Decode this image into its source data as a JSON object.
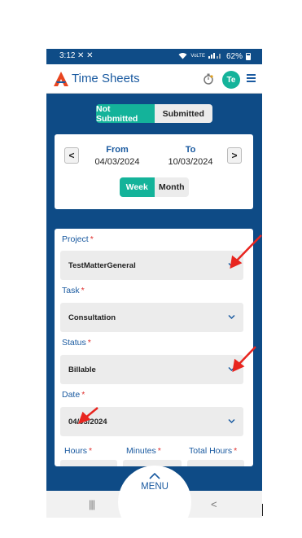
{
  "status_bar": {
    "time": "3:12",
    "notif_icons": "✕ ✕",
    "network": "VoLTE",
    "battery": "62%"
  },
  "header": {
    "title": "Time Sheets",
    "avatar_initials": "Te"
  },
  "submission_toggle": {
    "options": [
      "Not Submitted",
      "Submitted"
    ],
    "selected": "Not Submitted"
  },
  "date_range": {
    "from_label": "From",
    "from_value": "04/03/2024",
    "to_label": "To",
    "to_value": "10/03/2024",
    "prev": "<",
    "next": ">"
  },
  "range_toggle": {
    "options": [
      "Week",
      "Month"
    ],
    "selected": "Week"
  },
  "form": {
    "project": {
      "label": "Project",
      "value": "TestMatterGeneral"
    },
    "task": {
      "label": "Task",
      "value": "Consultation"
    },
    "status": {
      "label": "Status",
      "value": "Billable"
    },
    "date": {
      "label": "Date",
      "value": "04/03/2024"
    },
    "hours_label": "Hours",
    "minutes_label": "Minutes",
    "total_hours_label": "Total Hours",
    "required_mark": "*"
  },
  "menu": {
    "label": "MENU"
  },
  "nav": {
    "recents": "|||",
    "home": "○",
    "back": "<"
  },
  "colors": {
    "primary_blue": "#0e4b86",
    "accent_teal": "#14b39a",
    "required_red": "#e0312f",
    "annotation_red": "#e8251f"
  }
}
